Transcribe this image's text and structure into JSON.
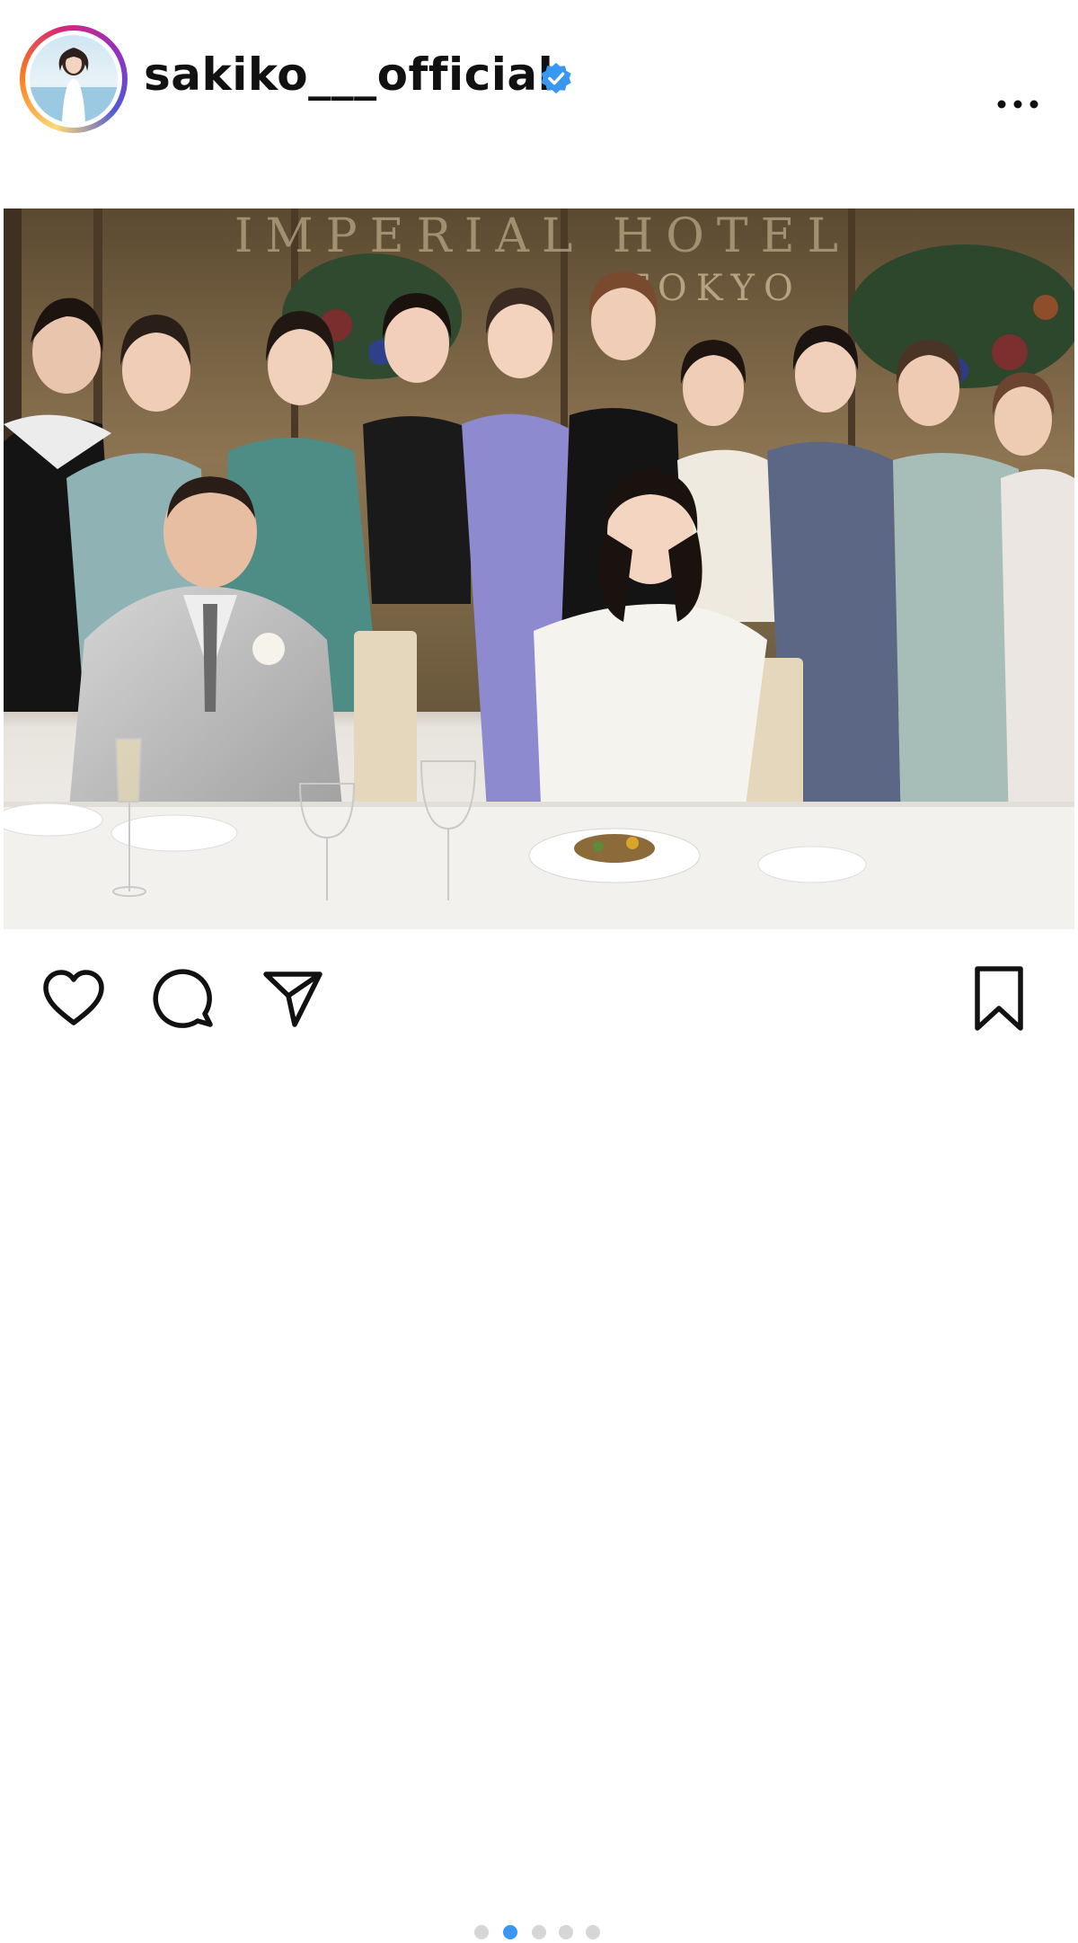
{
  "post": {
    "username": "sakiko___official",
    "verified": true,
    "colors": {
      "verified_badge": "#3897f0",
      "active_dot": "#3897f0",
      "inactive_dot": "#d6d6d6"
    }
  },
  "photo": {
    "sign_text_1": "IMPERIAL HOTEL",
    "sign_text_2": "TOKYO"
  },
  "carousel": {
    "count": 5,
    "active_index": 1
  },
  "actions": {
    "icons": [
      "heart-icon",
      "comment-icon",
      "share-icon",
      "bookmark-icon"
    ]
  }
}
